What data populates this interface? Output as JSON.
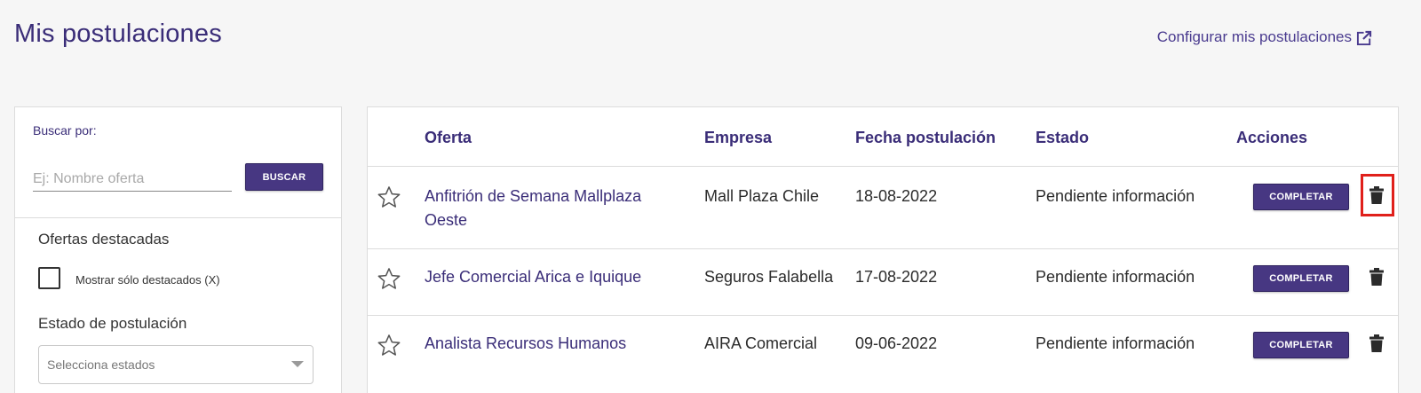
{
  "header": {
    "title": "Mis postulaciones",
    "config_link": "Configurar mis postulaciones",
    "config_icon": "external-link-icon"
  },
  "filters": {
    "search_label": "Buscar por:",
    "search_placeholder": "Ej: Nombre oferta",
    "search_value": "",
    "search_button": "BUSCAR",
    "featured_title": "Ofertas destacadas",
    "featured_checkbox_label": "Mostrar sólo destacados (X)",
    "featured_checked": false,
    "state_title": "Estado de postulación",
    "state_placeholder": "Selecciona estados"
  },
  "table": {
    "columns": [
      "Oferta",
      "Empresa",
      "Fecha postulación",
      "Estado",
      "Acciones"
    ],
    "rows": [
      {
        "offer_line1": "Anfitrión de Semana Mallplaza",
        "offer_line2": "Oeste",
        "company": "Mall Plaza Chile",
        "date": "18-08-2022",
        "status": "Pendiente información",
        "action": "COMPLETAR",
        "starred": false
      },
      {
        "offer_line1": "Jefe Comercial Arica e Iquique",
        "offer_line2": "",
        "company": "Seguros Falabella",
        "date": "17-08-2022",
        "status": "Pendiente información",
        "action": "COMPLETAR",
        "starred": false
      },
      {
        "offer_line1": "Analista Recursos Humanos",
        "offer_line2": "",
        "company": "AIRA Comercial",
        "date": "09-06-2022",
        "status": "Pendiente información",
        "action": "COMPLETAR",
        "starred": false
      }
    ]
  },
  "colors": {
    "primary": "#473782",
    "title": "#3a2d78",
    "highlight": "#e0201b",
    "background": "#f6f6f6"
  },
  "icons": {
    "star": "star-outline-icon",
    "delete": "trash-icon",
    "dropdown": "chevron-down-icon"
  }
}
